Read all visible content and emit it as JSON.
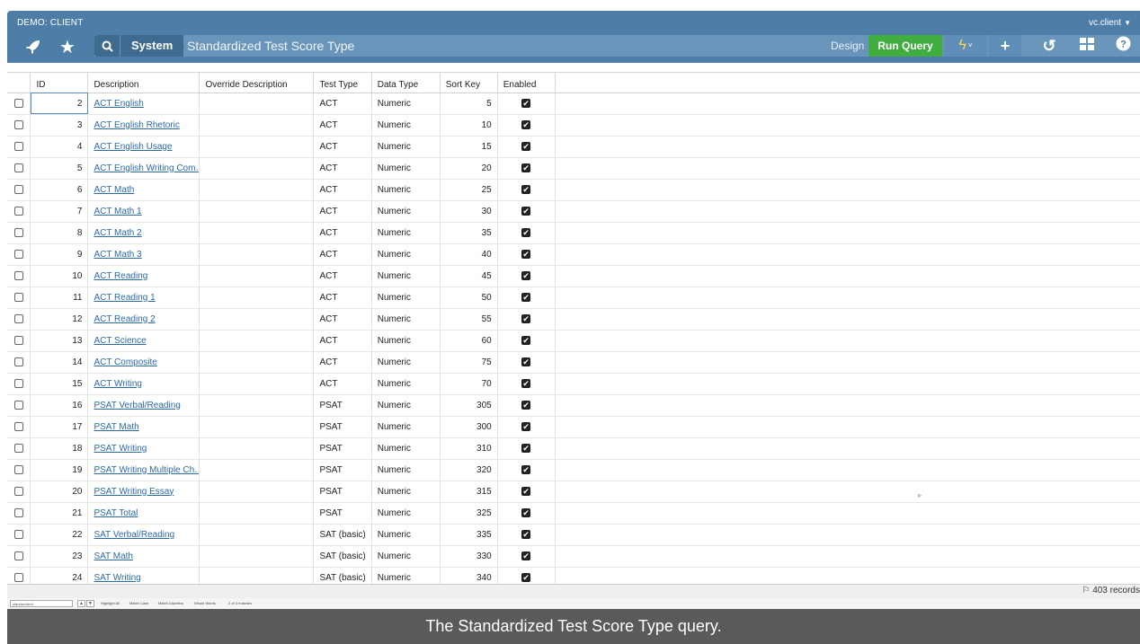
{
  "topbar": {
    "environment": "DEMO: CLIENT",
    "user": "vc.client",
    "breadcrumb_root": "System",
    "breadcrumb_current": "Standardized Test Score Type",
    "design_label": "Design",
    "run_query_label": "Run Query"
  },
  "table": {
    "headers": [
      "ID",
      "Description",
      "Override Description",
      "Test Type",
      "Data Type",
      "Sort Key",
      "Enabled"
    ],
    "rows": [
      {
        "id": "2",
        "description": "ACT English",
        "override": "",
        "test_type": "ACT",
        "data_type": "Numeric",
        "sort_key": "5"
      },
      {
        "id": "3",
        "description": "ACT English Rhetoric",
        "override": "",
        "test_type": "ACT",
        "data_type": "Numeric",
        "sort_key": "10"
      },
      {
        "id": "4",
        "description": "ACT English Usage",
        "override": "",
        "test_type": "ACT",
        "data_type": "Numeric",
        "sort_key": "15"
      },
      {
        "id": "5",
        "description": "ACT English Writing Com…",
        "override": "",
        "test_type": "ACT",
        "data_type": "Numeric",
        "sort_key": "20"
      },
      {
        "id": "6",
        "description": "ACT Math",
        "override": "",
        "test_type": "ACT",
        "data_type": "Numeric",
        "sort_key": "25"
      },
      {
        "id": "7",
        "description": "ACT Math 1",
        "override": "",
        "test_type": "ACT",
        "data_type": "Numeric",
        "sort_key": "30"
      },
      {
        "id": "8",
        "description": "ACT Math 2",
        "override": "",
        "test_type": "ACT",
        "data_type": "Numeric",
        "sort_key": "35"
      },
      {
        "id": "9",
        "description": "ACT Math 3",
        "override": "",
        "test_type": "ACT",
        "data_type": "Numeric",
        "sort_key": "40"
      },
      {
        "id": "10",
        "description": "ACT Reading",
        "override": "",
        "test_type": "ACT",
        "data_type": "Numeric",
        "sort_key": "45"
      },
      {
        "id": "11",
        "description": "ACT Reading 1",
        "override": "",
        "test_type": "ACT",
        "data_type": "Numeric",
        "sort_key": "50"
      },
      {
        "id": "12",
        "description": "ACT Reading 2",
        "override": "",
        "test_type": "ACT",
        "data_type": "Numeric",
        "sort_key": "55"
      },
      {
        "id": "13",
        "description": "ACT Science",
        "override": "",
        "test_type": "ACT",
        "data_type": "Numeric",
        "sort_key": "60"
      },
      {
        "id": "14",
        "description": "ACT Composite",
        "override": "",
        "test_type": "ACT",
        "data_type": "Numeric",
        "sort_key": "75"
      },
      {
        "id": "15",
        "description": "ACT Writing",
        "override": "",
        "test_type": "ACT",
        "data_type": "Numeric",
        "sort_key": "70"
      },
      {
        "id": "16",
        "description": "PSAT Verbal/Reading",
        "override": "",
        "test_type": "PSAT",
        "data_type": "Numeric",
        "sort_key": "305"
      },
      {
        "id": "17",
        "description": "PSAT Math",
        "override": "",
        "test_type": "PSAT",
        "data_type": "Numeric",
        "sort_key": "300"
      },
      {
        "id": "18",
        "description": "PSAT Writing",
        "override": "",
        "test_type": "PSAT",
        "data_type": "Numeric",
        "sort_key": "310"
      },
      {
        "id": "19",
        "description": "PSAT Writing Multiple Ch…",
        "override": "",
        "test_type": "PSAT",
        "data_type": "Numeric",
        "sort_key": "320"
      },
      {
        "id": "20",
        "description": "PSAT Writing Essay",
        "override": "",
        "test_type": "PSAT",
        "data_type": "Numeric",
        "sort_key": "315"
      },
      {
        "id": "21",
        "description": "PSAT Total",
        "override": "",
        "test_type": "PSAT",
        "data_type": "Numeric",
        "sort_key": "325"
      },
      {
        "id": "22",
        "description": "SAT Verbal/Reading",
        "override": "",
        "test_type": "SAT (basic)",
        "data_type": "Numeric",
        "sort_key": "335"
      },
      {
        "id": "23",
        "description": "SAT Math",
        "override": "",
        "test_type": "SAT (basic)",
        "data_type": "Numeric",
        "sort_key": "330"
      },
      {
        "id": "24",
        "description": "SAT Writing",
        "override": "",
        "test_type": "SAT (basic)",
        "data_type": "Numeric",
        "sort_key": "340"
      }
    ]
  },
  "footer": {
    "record_count": "403 records"
  },
  "findbar": {
    "query": "standardized",
    "highlight_all": "Highlight All",
    "match_case": "Match Case",
    "match_diacritics": "Match Diacritics",
    "whole_words": "Whole Words",
    "match_status": "2 of 3 matches"
  },
  "caption": "The Standardized Test Score Type query."
}
